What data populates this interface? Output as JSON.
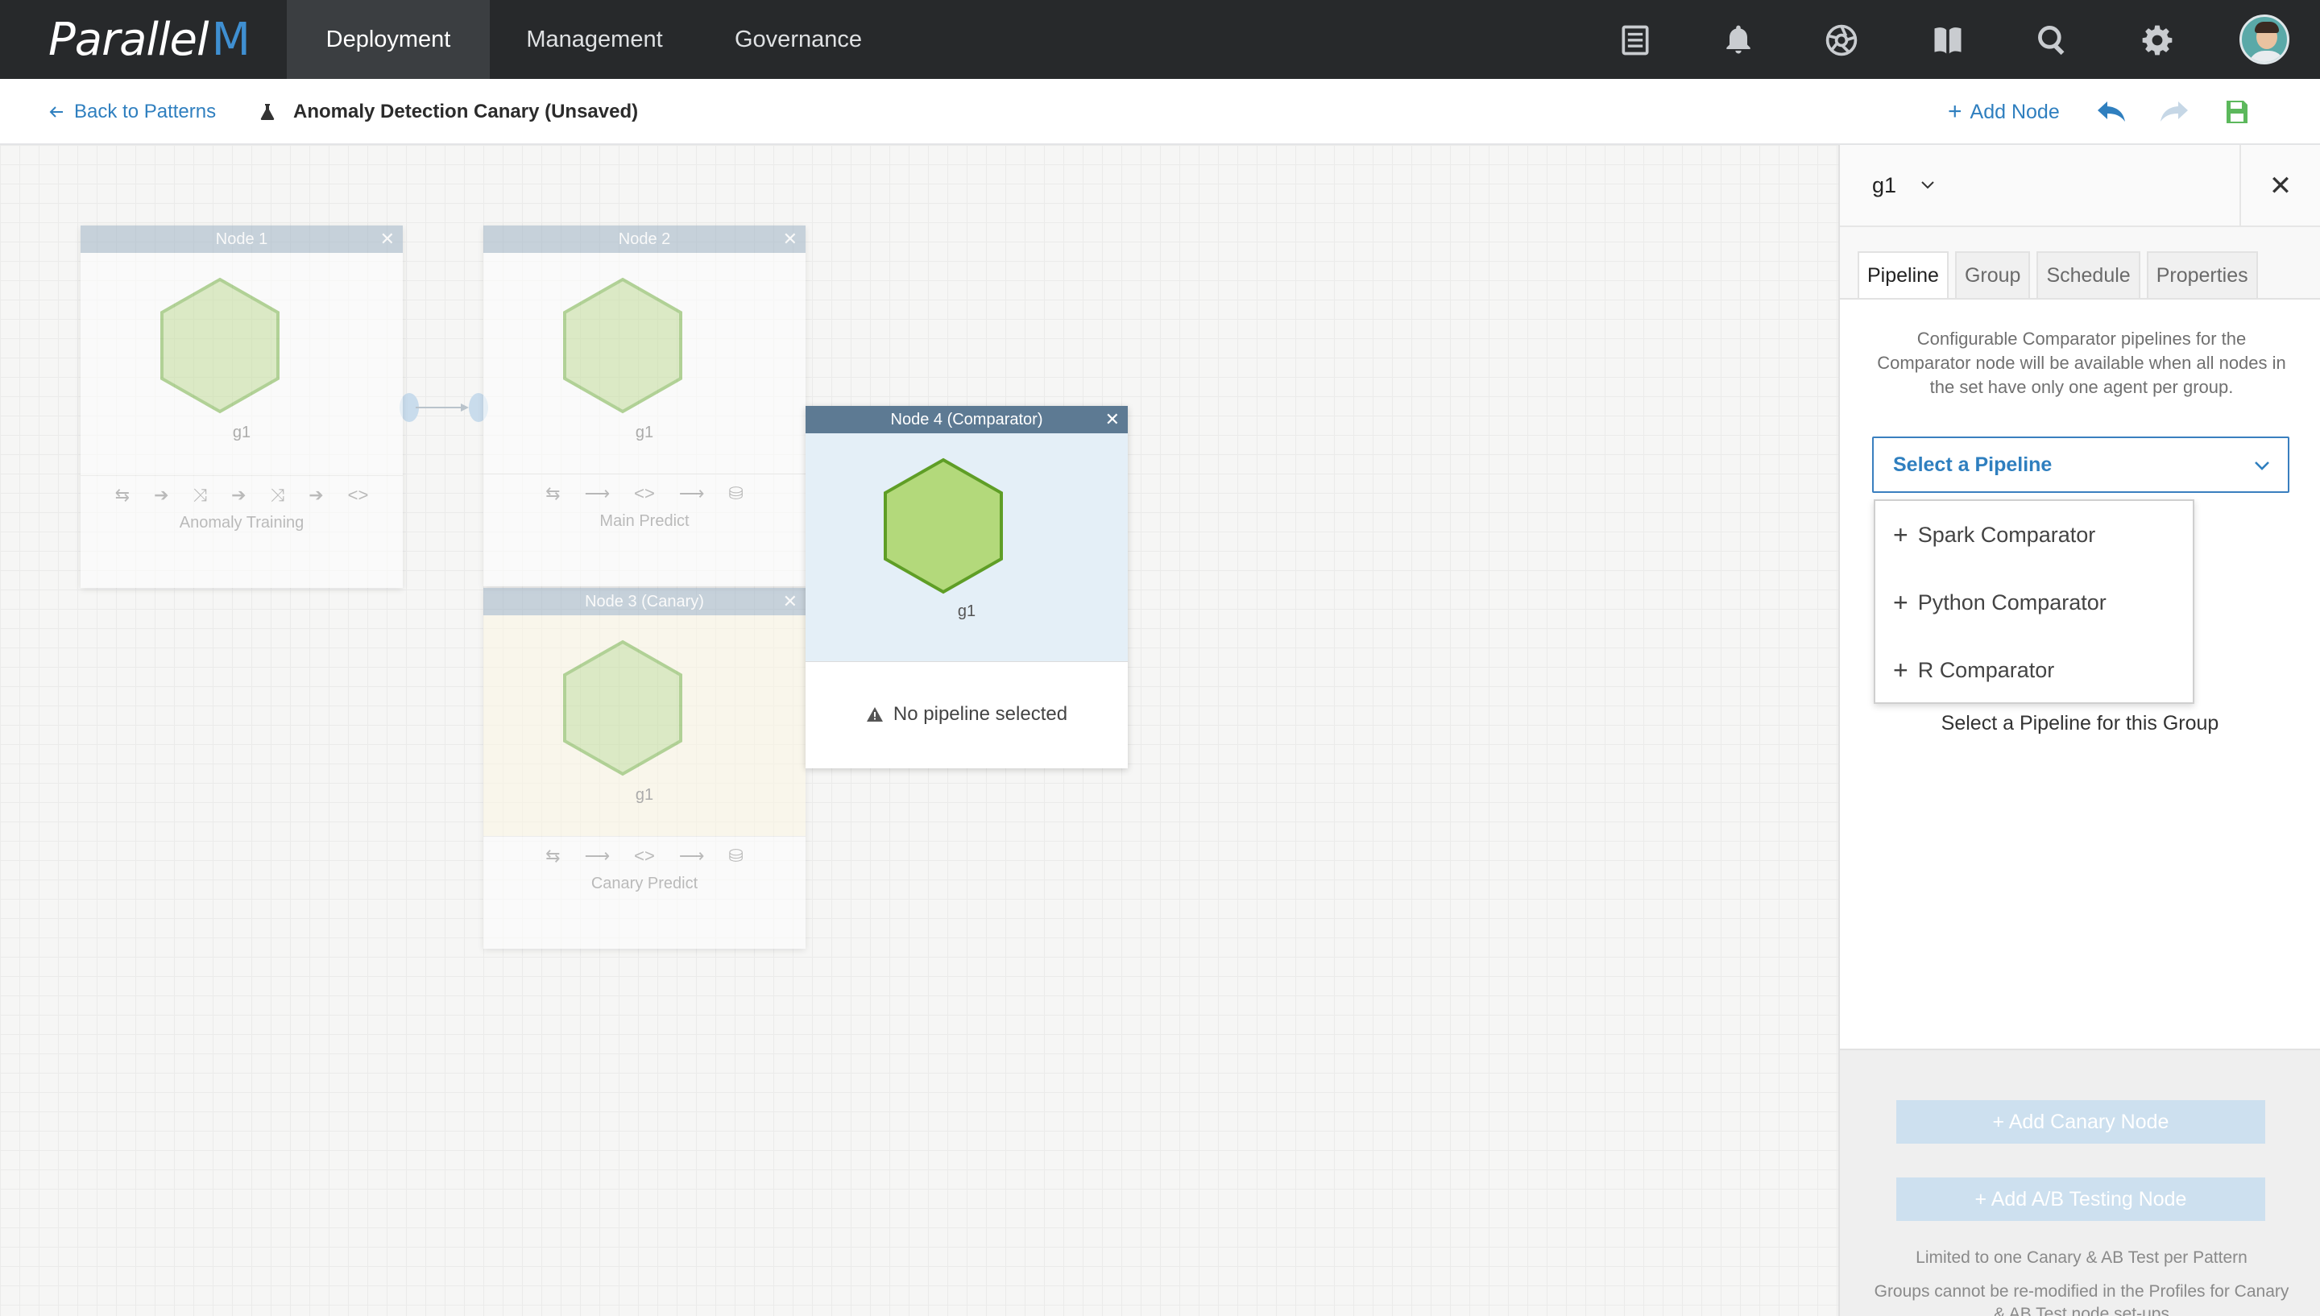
{
  "topnav": {
    "logo_text": "Parallel",
    "logo_mark": "M",
    "tabs": [
      {
        "label": "Deployment",
        "active": true
      },
      {
        "label": "Management",
        "active": false
      },
      {
        "label": "Governance",
        "active": false
      }
    ],
    "icons": [
      "document-icon",
      "bell-icon",
      "aperture-icon",
      "book-icon",
      "search-icon",
      "gear-icon",
      "avatar"
    ]
  },
  "subbar": {
    "back_label": "Back to Patterns",
    "pattern_title": "Anomaly Detection Canary (Unsaved)",
    "add_node_label": "Add Node"
  },
  "nodes": {
    "node1": {
      "title": "Node 1",
      "group": "g1",
      "name": "Anomaly Training"
    },
    "node2": {
      "title": "Node 2",
      "group": "g1",
      "name": "Main Predict"
    },
    "node3": {
      "title": "Node 3 (Canary)",
      "group": "g1",
      "name": "Canary Predict"
    },
    "node4": {
      "title": "Node 4 (Comparator)",
      "group": "g1",
      "status": "No pipeline selected"
    }
  },
  "panel": {
    "group_value": "g1",
    "tabs": [
      {
        "label": "Pipeline",
        "active": true
      },
      {
        "label": "Group",
        "active": false
      },
      {
        "label": "Schedule",
        "active": false
      },
      {
        "label": "Properties",
        "active": false
      }
    ],
    "description": "Configurable Comparator pipelines for the Comparator node will be available when all nodes in the set have only one agent per group.",
    "select_placeholder": "Select a Pipeline",
    "options": [
      "Spark Comparator",
      "Python Comparator",
      "R Comparator"
    ],
    "hint": "Select a Pipeline for this Group",
    "add_canary_label": "+ Add Canary Node",
    "add_ab_label": "+ Add A/B Testing Node",
    "note1": "Limited to one Canary & AB Test per Pattern",
    "note2": "Groups cannot be re-modified in the Profiles for Canary & AB Test node set-ups"
  },
  "colors": {
    "nav_bg": "#27292b",
    "accent": "#2f7fbf",
    "hex_fill": "#d4e8b8",
    "hex_stroke": "#6aa533",
    "comparator_bg": "#e4eff7"
  }
}
